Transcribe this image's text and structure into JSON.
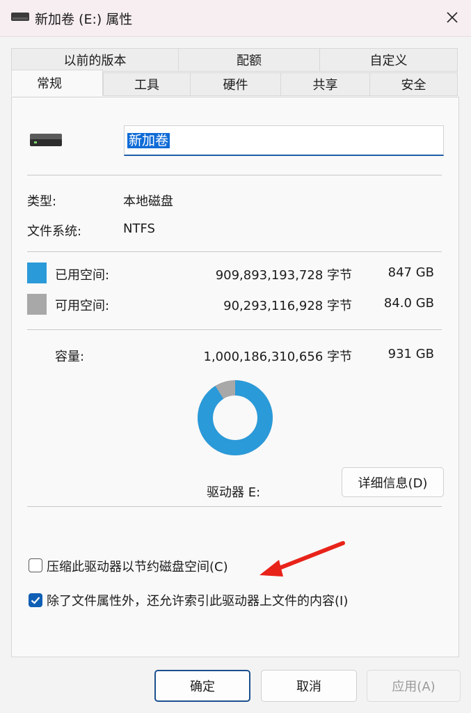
{
  "window": {
    "title": "新加卷 (E:) 属性"
  },
  "tabs_top": [
    "以前的版本",
    "配额",
    "自定义"
  ],
  "tabs_bottom": [
    "常规",
    "工具",
    "硬件",
    "共享",
    "安全"
  ],
  "general": {
    "volume_name": "新加卷",
    "type_label": "类型:",
    "type_value": "本地磁盘",
    "fs_label": "文件系统:",
    "fs_value": "NTFS",
    "used_label": "已用空间:",
    "used_bytes": "909,893,193,728 字节",
    "used_size": "847 GB",
    "free_label": "可用空间:",
    "free_bytes": "90,293,116,928 字节",
    "free_size": "84.0 GB",
    "capacity_label": "容量:",
    "capacity_bytes": "1,000,186,310,656 字节",
    "capacity_size": "931 GB",
    "drive_label": "驱动器 E:",
    "details_button": "详细信息(D)",
    "compress_label": "压缩此驱动器以节约磁盘空间(C)",
    "compress_checked": false,
    "index_label": "除了文件属性外，还允许索引此驱动器上文件的内容(I)",
    "index_checked": true,
    "used_fraction": 0.91,
    "used_color": "#2a9ad9",
    "free_color": "#a8a8a8"
  },
  "buttons": {
    "ok": "确定",
    "cancel": "取消",
    "apply": "应用(A)"
  }
}
